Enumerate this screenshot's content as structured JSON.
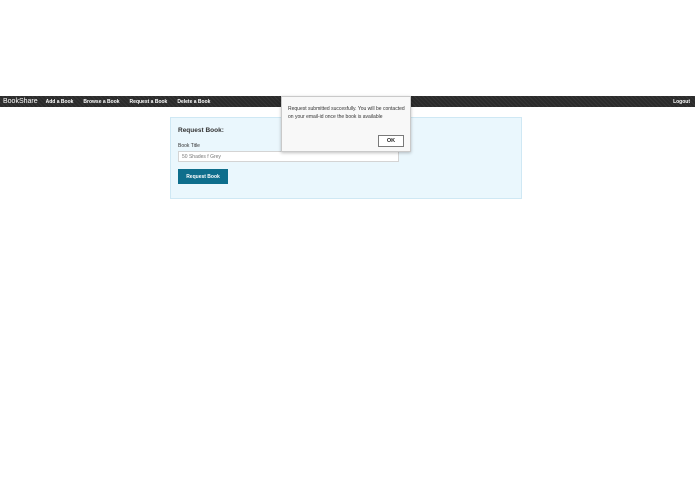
{
  "navbar": {
    "brand": "BookShare",
    "links": [
      "Add a Book",
      "Browse a Book",
      "Request a Book",
      "Delete a Book"
    ],
    "logout": "Logout"
  },
  "form": {
    "title": "Request Book:",
    "book_title_label": "Book Title",
    "book_title_value": "50 Shades f Grey",
    "submit_label": "Request Book"
  },
  "dialog": {
    "message": "Request submitted succesfully. You will be contacted on your email-id once the book is available",
    "ok_label": "OK"
  },
  "colors": {
    "navbar_bg": "#2b2b2b",
    "panel_bg": "#eaf7fd",
    "button_bg": "#0e6e8c"
  }
}
